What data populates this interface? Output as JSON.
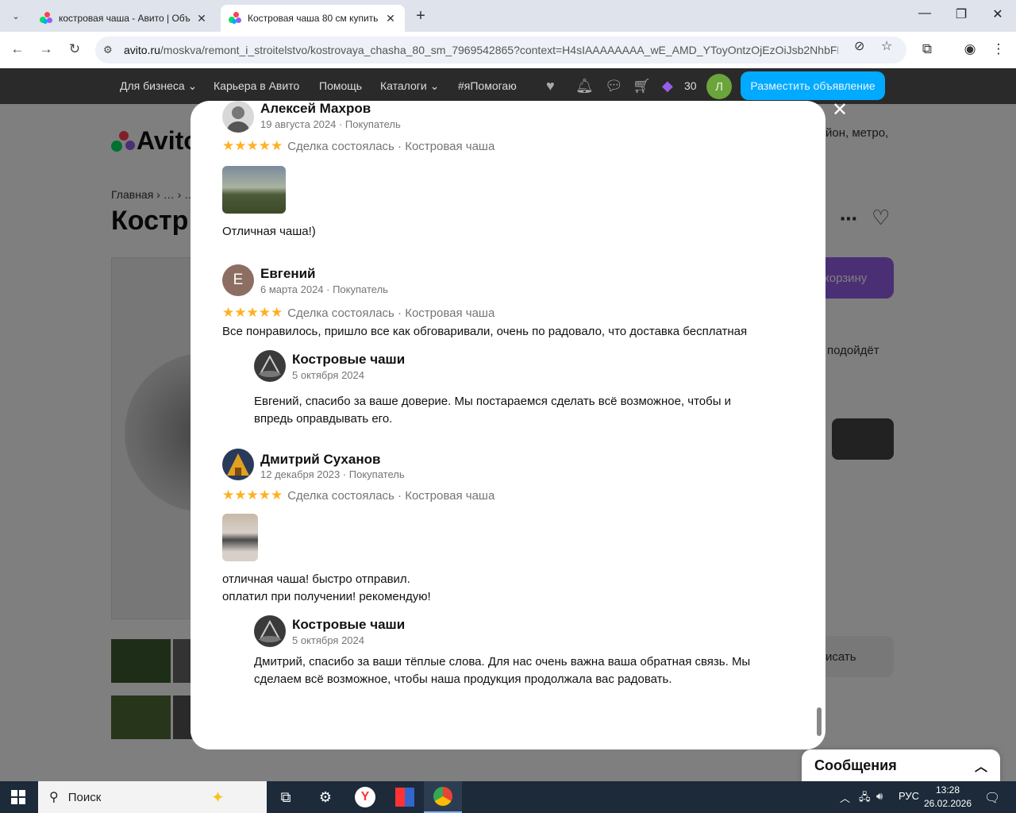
{
  "browser": {
    "tabs": [
      {
        "title": "костровая чаша - Авито | Объ",
        "active": false
      },
      {
        "title": "Костровая чаша 80 см купить",
        "active": true
      }
    ],
    "url_domain": "avito.ru",
    "url_path": "/moskva/remont_i_stroitelstvo/kostrovaya_chasha_80_sm_7969542865?context=H4sIAAAAAAAA_wE_AMD_YToyOntzOjEzOiJsb2NhbFBya..."
  },
  "avito_header": {
    "nav": [
      "Для бизнеса ⌄",
      "Карьера в Авито",
      "Помощь",
      "Каталоги ⌄",
      "#яПомогаю"
    ],
    "bonus_count": "30",
    "avatar_letter": "Л",
    "post_button": "Разместить объявление"
  },
  "background_page": {
    "logo": "Avito",
    "breadcrumb": "Главная › … › …",
    "title": "Костр",
    "search_hint": "йон, метро,",
    "cart_button": "корзину",
    "fit_text": "подойдёт",
    "write_button": "исать"
  },
  "reviews": [
    {
      "name": "Алексей Махров",
      "date": "19 августа 2024 · Покупатель",
      "stars": "★★★★★",
      "deal": "Сделка состоялась · Костровая чаша",
      "text": "Отличная чаша!)"
    },
    {
      "name": "Евгений",
      "avatar_letter": "Е",
      "avatar_color": "#8d6e63",
      "date": "6 марта 2024 · Покупатель",
      "stars": "★★★★★",
      "deal": "Сделка состоялась · Костровая чаша",
      "text": "Все понравилось, пришло все как обговаривали, очень по радовало, что доставка бесплатная",
      "reply": {
        "name": "Костровые чаши",
        "date": "5 октября 2024",
        "text": "Евгений, спасибо за ваше доверие. Мы постараемся сделать всё возможное, чтобы и\nвпредь оправдывать его."
      }
    },
    {
      "name": "Дмитрий Суханов",
      "date": "12 декабря 2023 · Покупатель",
      "stars": "★★★★★",
      "deal": "Сделка состоялась · Костровая чаша",
      "text": "отличная чаша! быстро отправил.\nоплатил при получении! рекомендую!",
      "reply": {
        "name": "Костровые чаши",
        "date": "5 октября 2024",
        "text": "Дмитрий, спасибо за ваши тёплые слова. Для нас очень важна ваша обратная связь. Мы\nсделаем всё возможное, чтобы наша продукция продолжала вас радовать."
      }
    }
  ],
  "messages_bar": {
    "label": "Сообщения"
  },
  "taskbar": {
    "search_label": "Поиск",
    "lang": "РУС",
    "time": "13:28",
    "date": "26.02.2026"
  },
  "colors": {
    "avito_blue": "#00aaff",
    "star": "#ffb021",
    "purple": "#965eeb"
  }
}
